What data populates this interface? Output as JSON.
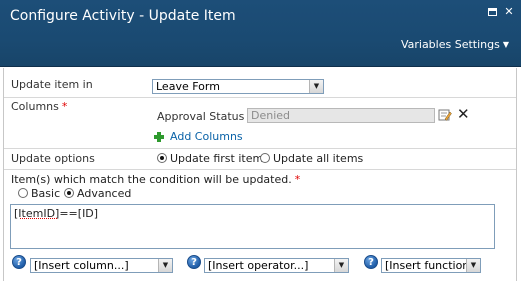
{
  "dialog": {
    "title": "Configure Activity - Update Item",
    "variables_settings": "Variables Settings"
  },
  "update_item_in": {
    "label": "Update item in",
    "value": "Leave Form"
  },
  "columns": {
    "label": "Columns",
    "required_mark": "*",
    "field_name": "Approval Status",
    "field_value": "Denied",
    "add_columns": "Add Columns"
  },
  "update_options": {
    "label": "Update options",
    "first_item": "Update first item",
    "all_items": "Update all items",
    "selected": "first_item"
  },
  "condition": {
    "label": "Item(s) which match the condition will be updated.",
    "required_mark": "*",
    "basic": "Basic",
    "advanced": "Advanced",
    "selected": "advanced",
    "expression_part1": "ItemID",
    "expression": "[ItemID]==[ID]"
  },
  "inserters": {
    "column": "[Insert column...]",
    "operator": "[Insert operator...]",
    "function": "[Insert function..."
  },
  "colors": {
    "titlebar": "#1d4e78",
    "link": "#0b63a8",
    "required": "#e00000",
    "add_icon": "#2e9a2e"
  },
  "icons": [
    "maximize-icon",
    "close-icon",
    "chevron-down-icon",
    "edit-icon",
    "delete-icon",
    "plus-icon",
    "help-icon"
  ]
}
